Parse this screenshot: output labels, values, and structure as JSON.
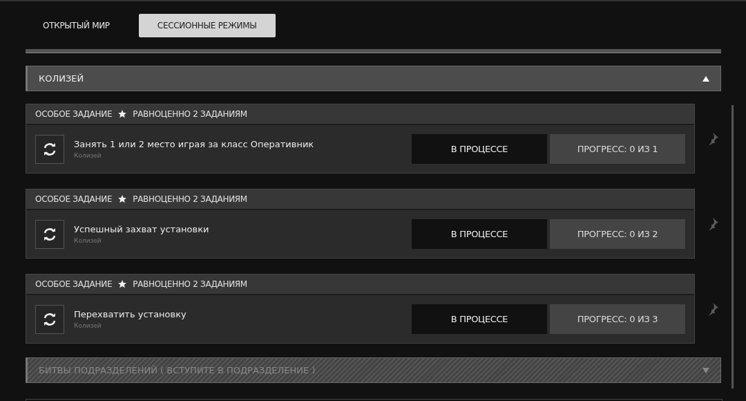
{
  "tabs": [
    {
      "label": "ОТКРЫТЫЙ МИР",
      "selected": false
    },
    {
      "label": "СЕССИОННЫЕ РЕЖИМЫ",
      "selected": true
    }
  ],
  "sections": [
    {
      "title": "КОЛИЗЕЙ",
      "expanded": true,
      "disabled": false,
      "quests": [
        {
          "tag": "ОСОБОЕ ЗАДАНИЕ",
          "equivalence": "РАВНОЦЕННО 2 ЗАДАНИЯМ",
          "title": "Занять 1 или 2 место играя за класс Оперативник",
          "subtitle": "Колизей",
          "status": "В ПРОЦЕССЕ",
          "progress": "ПРОГРЕСС: 0 ИЗ 1"
        },
        {
          "tag": "ОСОБОЕ ЗАДАНИЕ",
          "equivalence": "РАВНОЦЕННО 2 ЗАДАНИЯМ",
          "title": "Успешный захват установки",
          "subtitle": "Колизей",
          "status": "В ПРОЦЕССЕ",
          "progress": "ПРОГРЕСС: 0 ИЗ 2"
        },
        {
          "tag": "ОСОБОЕ ЗАДАНИЕ",
          "equivalence": "РАВНОЦЕННО 2 ЗАДАНИЯМ",
          "title": "Перехватить установку",
          "subtitle": "Колизей",
          "status": "В ПРОЦЕССЕ",
          "progress": "ПРОГРЕСС: 0 ИЗ 3"
        }
      ]
    },
    {
      "title": "БИТВЫ ПОДРАЗДЕЛЕНИЙ ( ВСТУПИТЕ В ПОДРАЗДЕЛЕНИЕ )",
      "expanded": false,
      "disabled": true
    }
  ]
}
